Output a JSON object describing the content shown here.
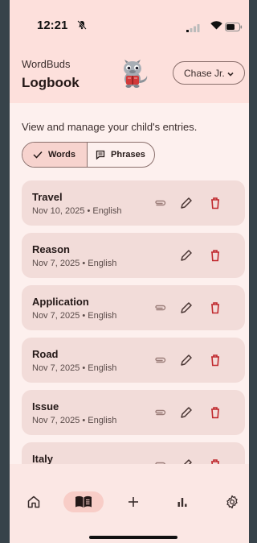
{
  "status_bar": {
    "time": "12:21"
  },
  "header": {
    "app_name": "WordBuds",
    "title": "Logbook",
    "profile": "Chase Jr."
  },
  "subtitle": "View and manage your child's entries.",
  "tabs": {
    "words": "Words",
    "phrases": "Phrases"
  },
  "entries": [
    {
      "word": "Travel",
      "meta": "Nov 10, 2025 • English",
      "has_attachment": true
    },
    {
      "word": "Reason",
      "meta": "Nov 7, 2025 • English",
      "has_attachment": false
    },
    {
      "word": "Application",
      "meta": "Nov 7, 2025 • English",
      "has_attachment": true
    },
    {
      "word": "Road",
      "meta": "Nov 7, 2025 • English",
      "has_attachment": true
    },
    {
      "word": "Issue",
      "meta": "Nov 7, 2025 • English",
      "has_attachment": true
    },
    {
      "word": "Italy",
      "meta": "",
      "has_attachment": true
    }
  ],
  "nav": [
    "home-icon",
    "logbook-icon",
    "plus-icon",
    "bar-chart-icon",
    "gear-icon"
  ],
  "colors": {
    "accent": "#f8cdc7",
    "card": "#f2dcd9",
    "delete": "#c0282d",
    "header": "#fde0dc"
  }
}
